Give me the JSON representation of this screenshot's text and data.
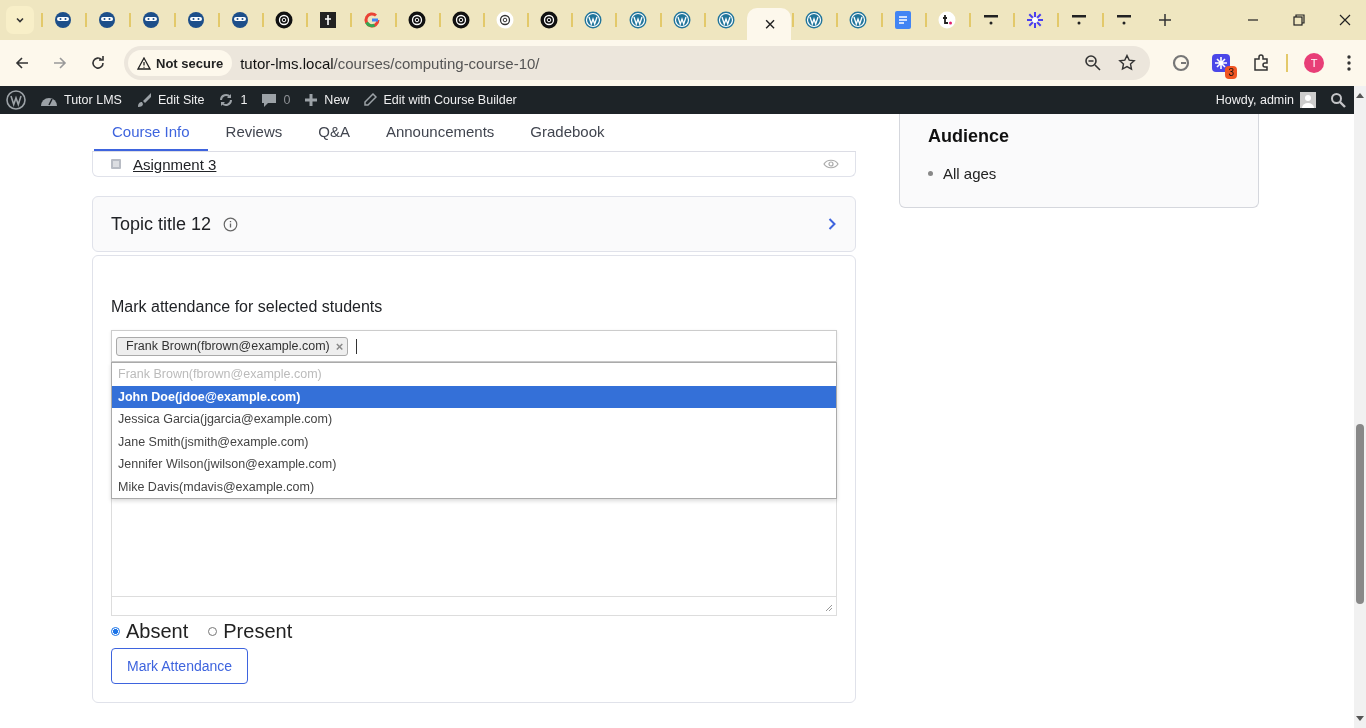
{
  "browser": {
    "tabs": [
      {
        "kind": "ninja",
        "selected": false
      },
      {
        "kind": "ninja",
        "selected": false
      },
      {
        "kind": "ninja",
        "selected": false
      },
      {
        "kind": "ninja",
        "selected": false
      },
      {
        "kind": "ninja",
        "selected": false
      },
      {
        "kind": "swirl-dark",
        "selected": false
      },
      {
        "kind": "tile",
        "selected": false
      },
      {
        "kind": "google",
        "selected": false
      },
      {
        "kind": "swirl-dark",
        "selected": false
      },
      {
        "kind": "swirl-dark",
        "selected": false
      },
      {
        "kind": "swirl-light",
        "selected": false
      },
      {
        "kind": "swirl-dark",
        "selected": false
      },
      {
        "kind": "wordpress",
        "selected": false
      },
      {
        "kind": "wordpress",
        "selected": false
      },
      {
        "kind": "wordpress",
        "selected": false
      },
      {
        "kind": "wordpress",
        "selected": false
      },
      {
        "selected": true,
        "close": "×"
      },
      {
        "kind": "wordpress",
        "selected": false
      },
      {
        "kind": "wordpress",
        "selected": false
      },
      {
        "kind": "docs",
        "selected": false
      },
      {
        "kind": "t-dot",
        "selected": false
      },
      {
        "kind": "bar",
        "selected": false
      },
      {
        "kind": "burst",
        "selected": false
      },
      {
        "kind": "bar",
        "selected": false
      },
      {
        "kind": "bar",
        "selected": false
      }
    ],
    "security": "Not secure",
    "url_host": "tutor-lms.local",
    "url_path": "/courses/computing-course-10/",
    "extension_badge": "3",
    "profile_initial": "T"
  },
  "admin_bar": {
    "items": [
      {
        "kind": "dashboard",
        "label": "Tutor LMS"
      },
      {
        "kind": "brush",
        "label": "Edit Site"
      },
      {
        "kind": "updates",
        "label": "1"
      },
      {
        "kind": "comments",
        "label": "0"
      },
      {
        "kind": "plus",
        "label": "New"
      },
      {
        "kind": "pencil",
        "label": "Edit with Course Builder"
      }
    ],
    "greeting": "Howdy, admin"
  },
  "course_tabs": [
    {
      "label": "Course Info",
      "selected": true
    },
    {
      "label": "Reviews",
      "selected": false
    },
    {
      "label": "Q&A",
      "selected": false
    },
    {
      "label": "Announcements",
      "selected": false
    },
    {
      "label": "Gradebook",
      "selected": false
    }
  ],
  "lesson": {
    "title": "Asignment 3"
  },
  "topic": {
    "title": "Topic title 12"
  },
  "attendance": {
    "heading": "Mark attendance for selected students",
    "chips": [
      "Frank Brown(fbrown@example.com)"
    ],
    "chip_remove": "×",
    "options": [
      {
        "label": "Frank Brown(fbrown@example.com)",
        "disabled": true,
        "selected": false
      },
      {
        "label": "John Doe(jdoe@example.com)",
        "disabled": false,
        "selected": true
      },
      {
        "label": "Jessica Garcia(jgarcia@example.com)",
        "disabled": false,
        "selected": false
      },
      {
        "label": "Jane Smith(jsmith@example.com)",
        "disabled": false,
        "selected": false
      },
      {
        "label": "Jennifer Wilson(jwilson@example.com)",
        "disabled": false,
        "selected": false
      },
      {
        "label": "Mike Davis(mdavis@example.com)",
        "disabled": false,
        "selected": false
      }
    ],
    "statuses": [
      {
        "label": "Absent",
        "selected": true
      },
      {
        "label": "Present",
        "selected": false
      }
    ],
    "button": "Mark Attendance"
  },
  "audience": {
    "heading": "Audience",
    "items": [
      "All ages"
    ]
  }
}
